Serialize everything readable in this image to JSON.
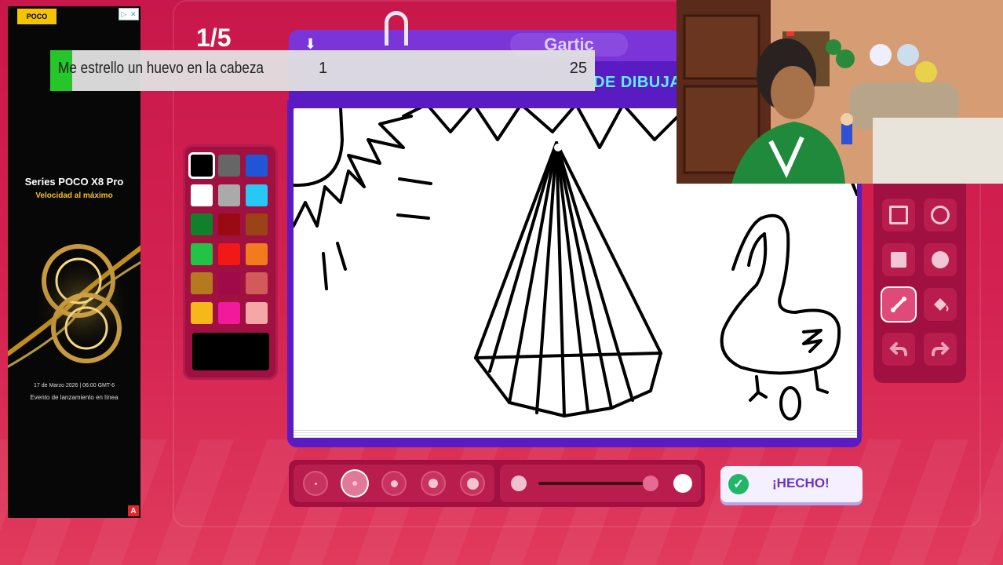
{
  "ad": {
    "brand": "POCO",
    "title": "Series POCO X8 Pro",
    "subtitle": "Velocidad al máximo",
    "date": "17 de Marzo 2026 | 06:00 GMT-6",
    "event": "Evento de lanzamiento en línea",
    "adchoices": "A"
  },
  "game": {
    "round": "1/5",
    "logo": "Gartic",
    "mode_label": "DE DIBUJA",
    "done_label": "¡HECHO!"
  },
  "overlay": {
    "text": "Me estrello un huevo en la cabeza",
    "count": "1",
    "total": "25",
    "accent": "#26c52a"
  },
  "palette": {
    "colors": [
      "#000000",
      "#666666",
      "#1f55d6",
      "#ffffff",
      "#aaaaaa",
      "#28c8f5",
      "#11802a",
      "#9a0a12",
      "#9a4316",
      "#22c445",
      "#f01818",
      "#f47a1e",
      "#b67a1e",
      "#a00a48",
      "#d35a5a",
      "#f6b71b",
      "#f21a9a",
      "#f5a6a6"
    ],
    "selected_index": 0,
    "current_color": "#000000"
  },
  "tools": [
    "rectangle-outline-icon",
    "ellipse-outline-icon",
    "rectangle-fill-icon",
    "ellipse-fill-icon",
    "line-icon",
    "fill-bucket-icon",
    "undo-icon",
    "redo-icon"
  ],
  "tools_active_index": 4,
  "brush_sizes": {
    "count": 5,
    "selected_index": 1
  },
  "opacity_slider": {
    "value": 0.95
  }
}
